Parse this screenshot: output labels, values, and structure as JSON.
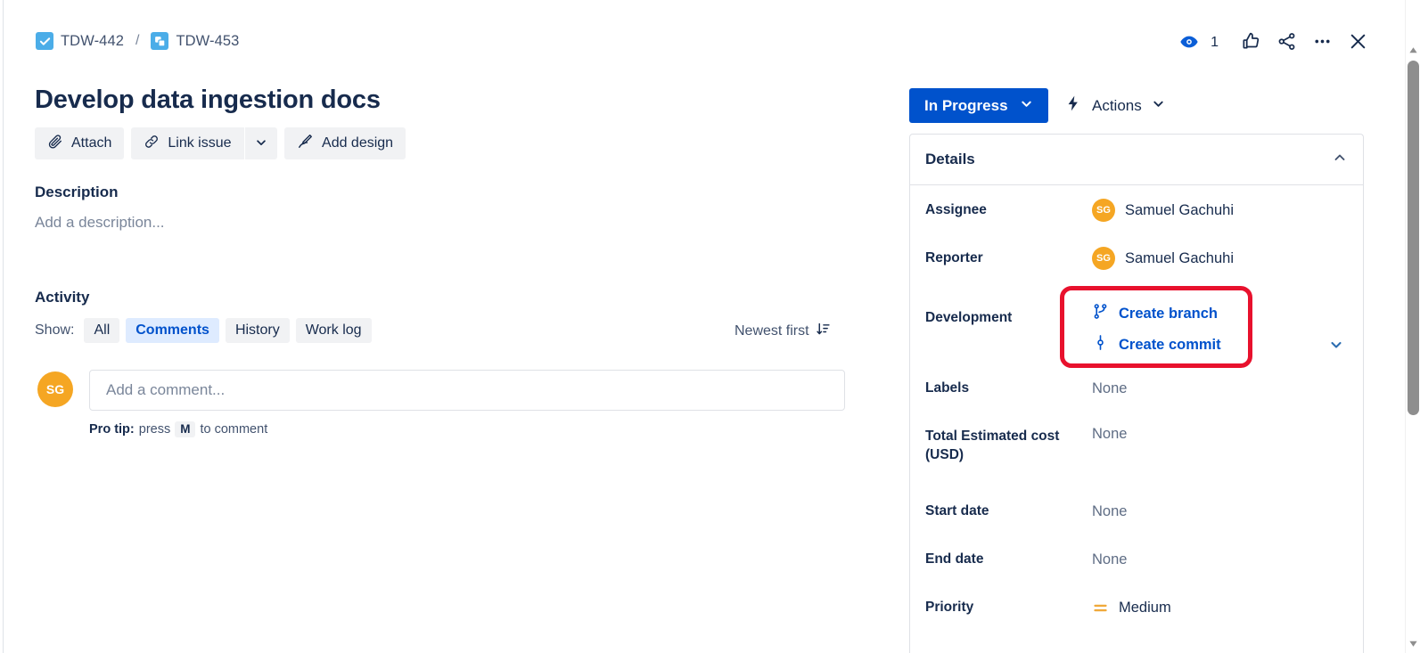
{
  "breadcrumb": {
    "parent": {
      "key": "TDW-442",
      "icon": "task-check-icon"
    },
    "separator": "/",
    "current": {
      "key": "TDW-453",
      "icon": "subtask-icon"
    }
  },
  "top_actions": {
    "watch_icon": "eye-icon",
    "watch_count": "1",
    "vote_icon": "thumbs-up-icon",
    "share_icon": "share-icon",
    "more_icon": "more-options-icon",
    "close_icon": "close-icon"
  },
  "issue": {
    "title": "Develop data ingestion docs"
  },
  "action_buttons": {
    "attach": "Attach",
    "link_issue": "Link issue",
    "link_issue_caret": "chevron-down-icon",
    "add_design": "Add design"
  },
  "description": {
    "heading": "Description",
    "placeholder": "Add a description..."
  },
  "activity": {
    "heading": "Activity",
    "show_label": "Show:",
    "filters": [
      {
        "label": "All",
        "selected": false
      },
      {
        "label": "Comments",
        "selected": true
      },
      {
        "label": "History",
        "selected": false
      },
      {
        "label": "Work log",
        "selected": false
      }
    ],
    "sort_label": "Newest first",
    "sort_icon": "sort-descending-icon"
  },
  "comment": {
    "avatar_initials": "SG",
    "placeholder": "Add a comment...",
    "value": "",
    "pro_tip_prefix": "Pro tip:",
    "pro_tip_press": "press",
    "pro_tip_key": "M",
    "pro_tip_suffix": "to comment"
  },
  "status": {
    "label": "In Progress",
    "caret": "chevron-down-icon",
    "color": "#0052CC"
  },
  "actions_menu": {
    "label": "Actions",
    "icon": "lightning-bolt-icon",
    "caret": "chevron-down-icon"
  },
  "details": {
    "heading": "Details",
    "collapse_icon": "chevron-up-icon",
    "fields": {
      "assignee": {
        "label": "Assignee",
        "value": "Samuel Gachuhi",
        "avatar": "SG"
      },
      "reporter": {
        "label": "Reporter",
        "value": "Samuel Gachuhi",
        "avatar": "SG"
      },
      "development": {
        "label": "Development",
        "create_branch": "Create branch",
        "create_branch_icon": "branch-icon",
        "create_commit": "Create commit",
        "create_commit_icon": "commit-icon",
        "caret": "chevron-down-icon"
      },
      "labels": {
        "label": "Labels",
        "value": "None"
      },
      "total_estimated_cost": {
        "label": "Total Estimated cost (USD)",
        "value": "None"
      },
      "start_date": {
        "label": "Start date",
        "value": "None"
      },
      "end_date": {
        "label": "End date",
        "value": "None"
      },
      "priority": {
        "label": "Priority",
        "value": "Medium",
        "icon": "priority-medium-icon",
        "icon_color": "#F0A93B"
      }
    }
  },
  "annotation": {
    "color": "#E8112D",
    "target": "development-create-branch-commit"
  }
}
